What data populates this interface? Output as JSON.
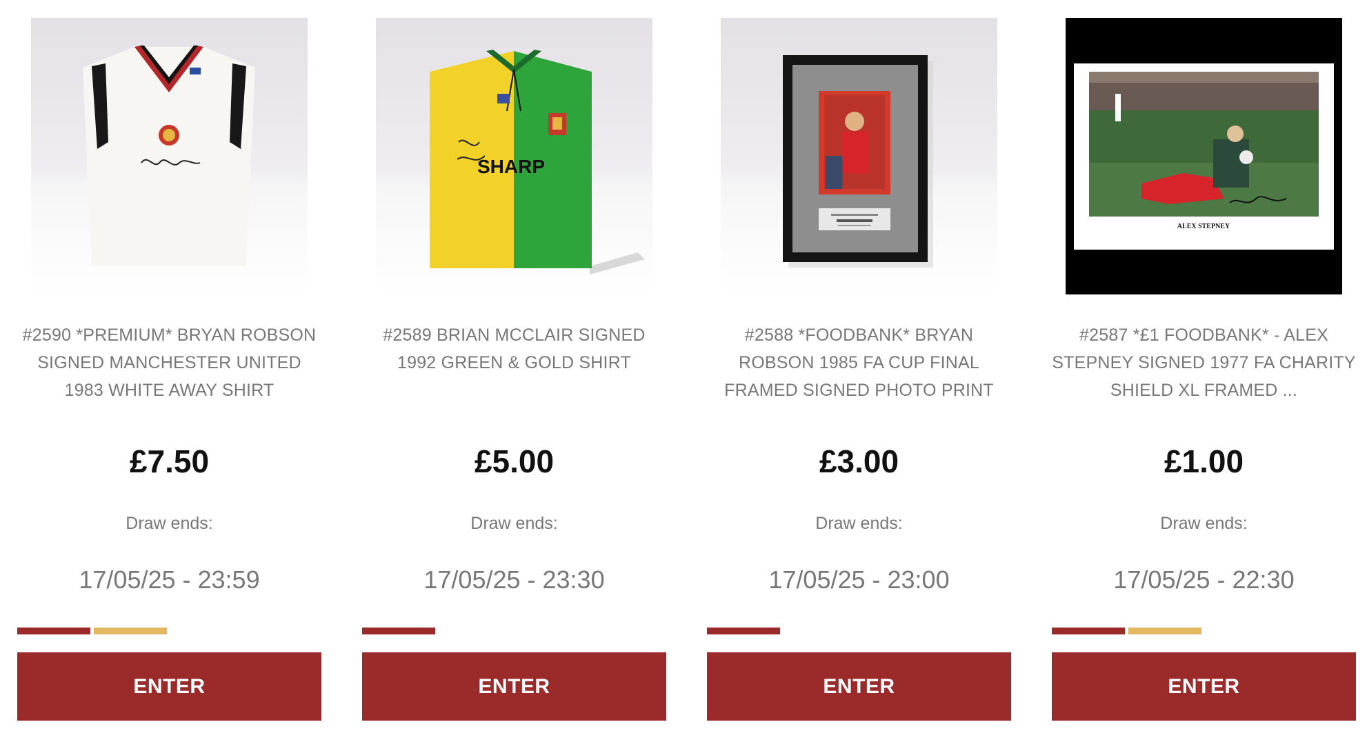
{
  "theme": {
    "accent": "#9b2a2a",
    "gold": "#e3b862",
    "track": "#ffffff",
    "price_color": "#111111",
    "muted_text": "#777777"
  },
  "competitions": [
    {
      "image_icon": "signed-white-away-shirt-image",
      "title": "#2590 *PREMIUM* BRYAN ROBSON SIGNED MANCHESTER UNITED 1983 WHITE AWAY SHIRT",
      "price": "£7.50",
      "draw_label": "Draw ends:",
      "draw_date": "17/05/25 - 23:59",
      "progress_segments": [
        "accent",
        "gold",
        "none",
        "none"
      ],
      "button_label": "ENTER"
    },
    {
      "image_icon": "signed-green-gold-shirt-image",
      "title": "#2589 BRIAN MCCLAIR SIGNED 1992 GREEN & GOLD SHIRT",
      "price": "£5.00",
      "draw_label": "Draw ends:",
      "draw_date": "17/05/25 - 23:30",
      "progress_segments": [
        "accent",
        "none",
        "none",
        "none"
      ],
      "button_label": "ENTER"
    },
    {
      "image_icon": "framed-photo-print-image",
      "title": "#2588 *FOODBANK* BRYAN ROBSON 1985 FA CUP FINAL FRAMED SIGNED PHOTO PRINT",
      "price": "£3.00",
      "draw_label": "Draw ends:",
      "draw_date": "17/05/25 - 23:00",
      "progress_segments": [
        "accent",
        "none",
        "none",
        "none"
      ],
      "button_label": "ENTER"
    },
    {
      "image_icon": "signed-xl-framed-print-image",
      "title": "#2587 *£1 FOODBANK* - ALEX STEPNEY SIGNED 1977 FA CHARITY SHIELD XL FRAMED ...",
      "price": "£1.00",
      "draw_label": "Draw ends:",
      "draw_date": "17/05/25 - 22:30",
      "progress_segments": [
        "accent",
        "gold",
        "none",
        "none"
      ],
      "button_label": "ENTER",
      "image_caption": "ALEX STEPNEY"
    }
  ]
}
